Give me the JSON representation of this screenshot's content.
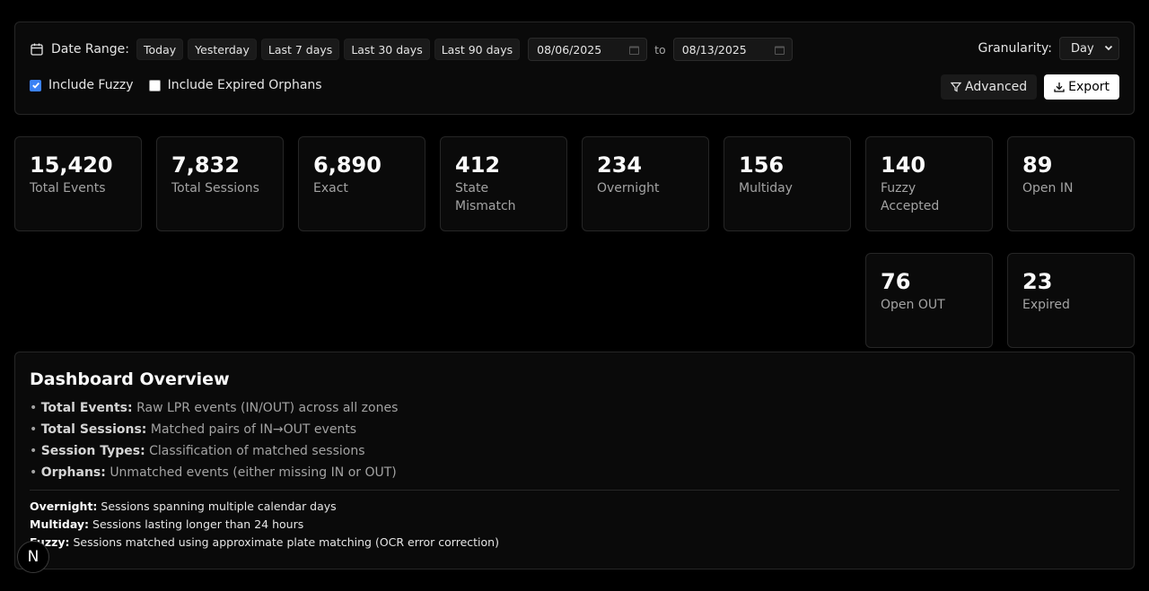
{
  "filters": {
    "date_range_label": "Date Range:",
    "quick_ranges": [
      "Today",
      "Yesterday",
      "Last 7 days",
      "Last 30 days",
      "Last 90 days"
    ],
    "start_date": "08/06/2025",
    "to_label": "to",
    "end_date": "08/13/2025",
    "granularity_label": "Granularity:",
    "granularity_value": "Day",
    "include_fuzzy_label": "Include Fuzzy",
    "include_fuzzy_checked": true,
    "include_expired_label": "Include Expired Orphans",
    "include_expired_checked": false,
    "advanced_label": "Advanced",
    "export_label": "Export"
  },
  "stats": [
    {
      "value": "15,420",
      "label": "Total Events"
    },
    {
      "value": "7,832",
      "label": "Total Sessions"
    },
    {
      "value": "6,890",
      "label": "Exact"
    },
    {
      "value": "412",
      "label": "State Mismatch"
    },
    {
      "value": "234",
      "label": "Overnight"
    },
    {
      "value": "156",
      "label": "Multiday"
    },
    {
      "value": "140",
      "label": "Fuzzy Accepted"
    },
    {
      "value": "89",
      "label": "Open IN"
    },
    {
      "value": "76",
      "label": "Open OUT"
    },
    {
      "value": "23",
      "label": "Expired"
    }
  ],
  "overview": {
    "title": "Dashboard Overview",
    "items": [
      {
        "term": "Total Events:",
        "desc": "Raw LPR events (IN/OUT) across all zones"
      },
      {
        "term": "Total Sessions:",
        "desc": "Matched pairs of IN→OUT events"
      },
      {
        "term": "Session Types:",
        "desc": "Classification of matched sessions"
      },
      {
        "term": "Orphans:",
        "desc": "Unmatched events (either missing IN or OUT)"
      }
    ],
    "notes": [
      {
        "term": "Overnight:",
        "desc": "Sessions spanning multiple calendar days"
      },
      {
        "term": "Multiday:",
        "desc": "Sessions lasting longer than 24 hours"
      },
      {
        "term": "Fuzzy:",
        "desc": "Sessions matched using approximate plate matching (OCR error correction)"
      }
    ]
  },
  "badge": {
    "letter": "N"
  },
  "colors": {
    "accent": "#3b82f6",
    "background": "#000000",
    "card": "#0a0a0a"
  }
}
